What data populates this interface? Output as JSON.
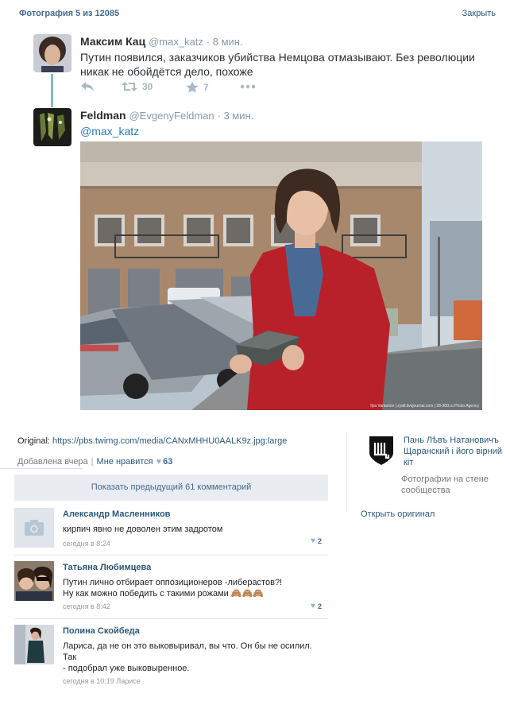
{
  "header": {
    "counter": "Фотография 5 из 12085",
    "close_label": "Закрыть"
  },
  "tweet1": {
    "name": "Максим Кац",
    "handle": "@max_katz",
    "time": "· 8 мин.",
    "text_line1": "Путин появился, заказчиков убийства Немцова отмазывают. Без революции",
    "text_line2": "никак не обойдётся дело, похоже",
    "retweets": "30",
    "favorites": "7"
  },
  "tweet2": {
    "name": "Feldman",
    "handle": "@EvgenyFeldman",
    "time": "· 3 мин.",
    "mention": "@max_katz"
  },
  "photo": {
    "credit": "Ilya Varlamov | zyalt.livejournal.com | 28-300.ru Photo Agency"
  },
  "original": {
    "label": "Original:",
    "url": "https://pbs.twimg.com/media/CANxMHHU0AALK9z.jpg:large"
  },
  "meta": {
    "added": "Добавлена вчера",
    "separator": "|",
    "like_label": "Мне нравится",
    "likes": "63"
  },
  "show_previous": "Показать предыдущий 61 комментарий",
  "comments": [
    {
      "name": "Александр Масленников",
      "text_line1": "кирпич явно не доволен этим задротом",
      "text_line2": "",
      "date": "сегодня в 8:24",
      "likes": "2"
    },
    {
      "name": "Татьяна Любимцева",
      "text_line1": "Путин лично отбирает оппозиционеров -либерастов?!",
      "text_line2": "Ну как можно победить с такими рожами 🙈🙈🙈",
      "date": "сегодня в 8:42",
      "likes": "2"
    },
    {
      "name": "Полина Скойбеда",
      "text_line1": "Лариса, да не он это выковыривал, вы что. Он бы не осилил. Так",
      "text_line2": "- подобрал уже выковыренное.",
      "date": "сегодня в 10:19 Ларисе",
      "likes": ""
    }
  ],
  "sidebar": {
    "group_name": "Пань Лѣвъ Натановичъ Щаранский і його вірний кіт",
    "caption": "Фотографии на стене сообщества",
    "open_original": "Открыть оригинал"
  },
  "colors": {
    "link": "#2b587a",
    "accent": "#45688e",
    "thread": "#7fbbc1"
  }
}
